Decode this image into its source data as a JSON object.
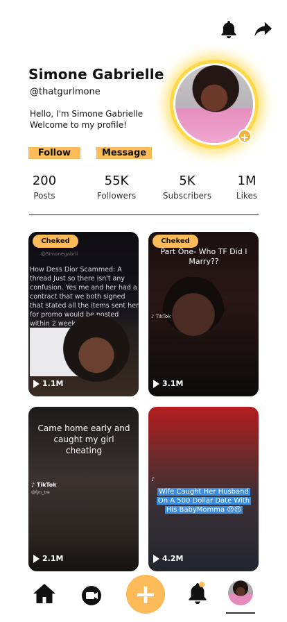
{
  "header": {
    "bell_icon": "bell-icon",
    "share_icon": "share-icon"
  },
  "profile": {
    "name": "Simone Gabrielle",
    "handle": "@thatgurlmone",
    "bio_line1": "Hello, I'm Simone Gabrielle",
    "bio_line2": "Welcome to my profile!",
    "follow_label": "Follow",
    "message_label": "Message"
  },
  "stats": [
    {
      "value": "200",
      "label": "Posts"
    },
    {
      "value": "55K",
      "label": "Followers"
    },
    {
      "value": "5K",
      "label": "Subscribers"
    },
    {
      "value": "1M",
      "label": "Likes"
    }
  ],
  "videos": [
    {
      "badge": "Cheked",
      "text": "How Dess Dior Scammed: A thread Just so there isn't any confusion. Yes me and her had a contract that we both signed that stated all the items sent her for promo would be posted within 2 week",
      "views": "1.1M"
    },
    {
      "badge": "Cheked",
      "text": "Part One- Who TF Did I Marry??",
      "views": "3.1M"
    },
    {
      "badge": "",
      "text": "Came home early and caught my girl cheating",
      "watermark": "TikTok",
      "views": "2.1M"
    },
    {
      "badge": "",
      "text": "Wife Caught Her Husband On A 500 Dollar Date With His BabyMomma 😔😔",
      "views": "4.2M"
    }
  ],
  "colors": {
    "accent": "#fcbb58",
    "avatar_glow": "#ffd84a",
    "caption_highlight": "#3b8de0"
  }
}
